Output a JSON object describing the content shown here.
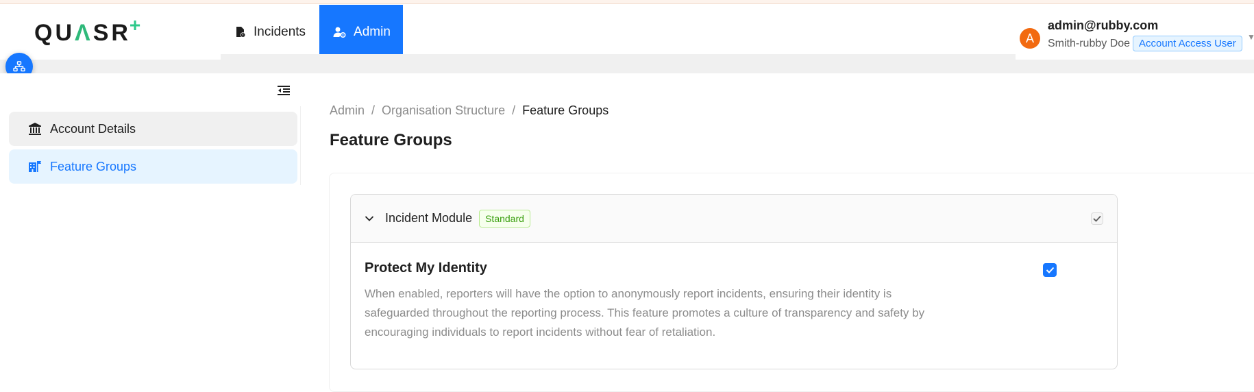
{
  "brand": {
    "logo_q": "QU",
    "logo_lambda": "Λ",
    "logo_sr": "SR",
    "logo_plus": "+"
  },
  "nav": {
    "items": [
      {
        "label": "Incidents",
        "icon": "incident-file-icon"
      },
      {
        "label": "Admin",
        "icon": "admin-user-icon",
        "active": true
      }
    ]
  },
  "user": {
    "avatar_initial": "A",
    "email": "admin@rubby.com",
    "name": "Smith-rubby Doe",
    "role": "Account Access User"
  },
  "sidebar": {
    "items": [
      {
        "label": "Account Details",
        "icon": "bank-icon"
      },
      {
        "label": "Feature Groups",
        "icon": "building-icon",
        "active": true
      }
    ]
  },
  "breadcrumb": [
    "Admin",
    "Organisation Structure",
    "Feature Groups"
  ],
  "page_title": "Feature Groups",
  "module": {
    "title": "Incident Module",
    "tag": "Standard",
    "checked": true,
    "features": [
      {
        "title": "Protect My Identity",
        "description": "When enabled, reporters will have the option to anonymously report incidents, ensuring their identity is safeguarded throughout the reporting process. This feature promotes a culture of transparency and safety by encouraging individuals to report incidents without fear of retaliation.",
        "enabled": true
      }
    ]
  },
  "colors": {
    "primary": "#1677ff",
    "avatar": "#f26a10",
    "tag_green": "#389e0d",
    "logo_accent": "#2ec98a"
  }
}
